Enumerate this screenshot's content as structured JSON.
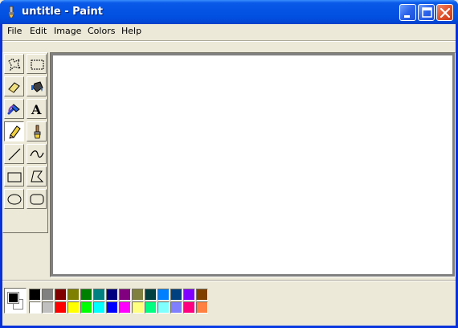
{
  "window": {
    "title": "untitle - Paint",
    "controls": [
      "minimize",
      "maximize",
      "close"
    ]
  },
  "menu": {
    "items": [
      "File",
      "Edit",
      "Image",
      "Colors",
      "Help"
    ]
  },
  "tools": [
    {
      "name": "free-form-select",
      "icon": "free-form-select-icon",
      "selected": false
    },
    {
      "name": "rect-select",
      "icon": "rect-select-icon",
      "selected": false
    },
    {
      "name": "eraser",
      "icon": "eraser-icon",
      "selected": false
    },
    {
      "name": "fill",
      "icon": "paint-bucket-icon",
      "selected": false
    },
    {
      "name": "pick-color",
      "icon": "eyedropper-icon",
      "selected": false
    },
    {
      "name": "text",
      "icon": "text-icon",
      "selected": false
    },
    {
      "name": "pencil",
      "icon": "pencil-icon",
      "selected": true
    },
    {
      "name": "brush",
      "icon": "brush-icon",
      "selected": false
    },
    {
      "name": "line",
      "icon": "line-icon",
      "selected": false
    },
    {
      "name": "curve",
      "icon": "curve-icon",
      "selected": false
    },
    {
      "name": "rectangle",
      "icon": "rectangle-icon",
      "selected": false
    },
    {
      "name": "polygon",
      "icon": "polygon-icon",
      "selected": false
    },
    {
      "name": "ellipse",
      "icon": "ellipse-icon",
      "selected": false
    },
    {
      "name": "rounded-rectangle",
      "icon": "rounded-rectangle-icon",
      "selected": false
    }
  ],
  "text_tool_glyph": "A",
  "colors": {
    "foreground": "#000000",
    "background": "#ffffff",
    "palette_top": [
      "#000000",
      "#808080",
      "#800000",
      "#808000",
      "#008000",
      "#008080",
      "#000080",
      "#800080",
      "#808040",
      "#004040",
      "#0080ff",
      "#004080",
      "#8000ff",
      "#804000"
    ],
    "palette_bottom": [
      "#ffffff",
      "#c0c0c0",
      "#ff0000",
      "#ffff00",
      "#00ff00",
      "#00ffff",
      "#0000ff",
      "#ff00ff",
      "#ffff80",
      "#00ff80",
      "#80ffff",
      "#8080ff",
      "#ff0080",
      "#ff8040"
    ]
  }
}
